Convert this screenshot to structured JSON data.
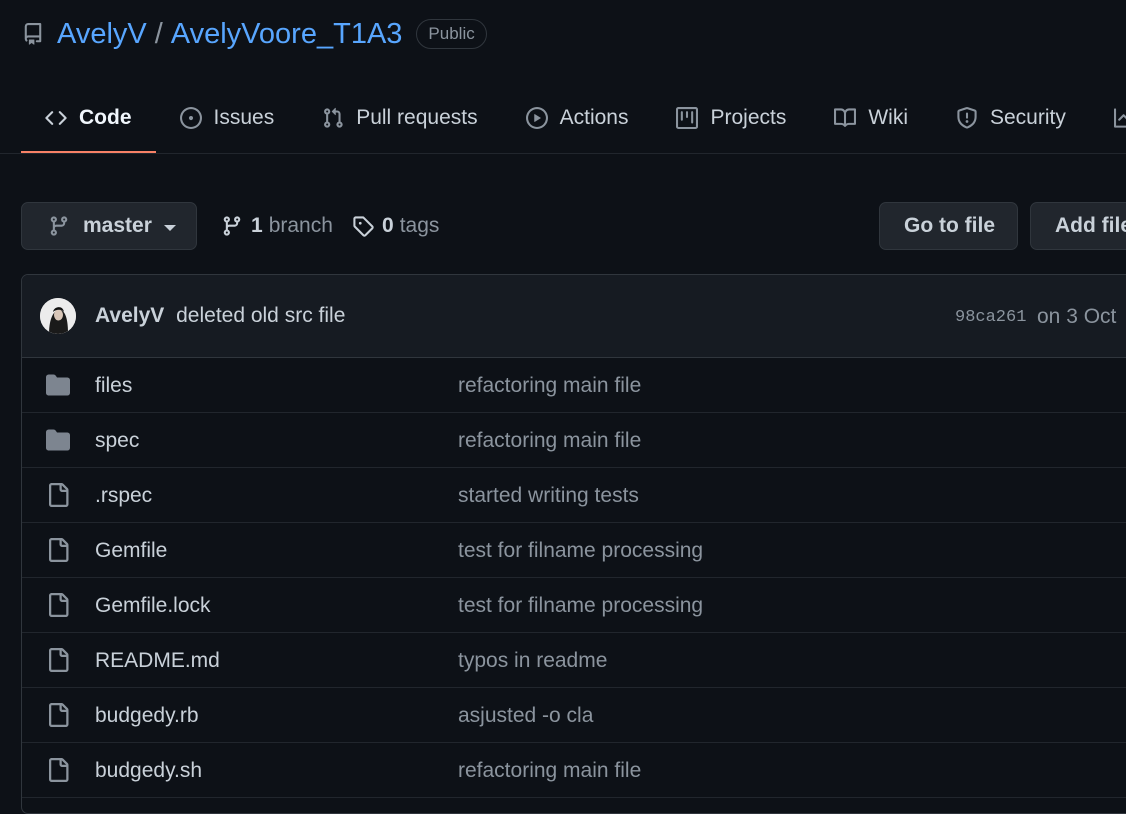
{
  "repo": {
    "owner": "AvelyV",
    "separator": "/",
    "name": "AvelyVoore_T1A3",
    "visibility": "Public"
  },
  "tabs": [
    {
      "label": "Code",
      "icon": "code-icon",
      "active": true
    },
    {
      "label": "Issues",
      "icon": "issue-icon"
    },
    {
      "label": "Pull requests",
      "icon": "pull-request-icon"
    },
    {
      "label": "Actions",
      "icon": "play-icon"
    },
    {
      "label": "Projects",
      "icon": "project-icon"
    },
    {
      "label": "Wiki",
      "icon": "book-icon"
    },
    {
      "label": "Security",
      "icon": "shield-icon"
    }
  ],
  "branch_bar": {
    "branch": "master",
    "branch_count": "1",
    "branch_word": "branch",
    "tag_count": "0",
    "tag_word": "tags",
    "go_to_file": "Go to file",
    "add_file": "Add file"
  },
  "latest_commit": {
    "author": "AvelyV",
    "message": "deleted old src file",
    "sha": "98ca261",
    "date": "on 3 Oct"
  },
  "files": [
    {
      "name": "files",
      "type": "dir",
      "message": "refactoring main file"
    },
    {
      "name": "spec",
      "type": "dir",
      "message": "refactoring main file"
    },
    {
      "name": ".rspec",
      "type": "file",
      "message": "started writing tests"
    },
    {
      "name": "Gemfile",
      "type": "file",
      "message": "test for filname processing"
    },
    {
      "name": "Gemfile.lock",
      "type": "file",
      "message": "test for filname processing"
    },
    {
      "name": "README.md",
      "type": "file",
      "message": "typos in readme"
    },
    {
      "name": "budgedy.rb",
      "type": "file",
      "message": "asjusted -o cla"
    },
    {
      "name": "budgedy.sh",
      "type": "file",
      "message": "refactoring main file"
    }
  ],
  "colors": {
    "background": "#0d1117",
    "link": "#58a6ff",
    "active_tab_underline": "#f78166",
    "border": "#30363d",
    "muted": "#8b949e"
  }
}
